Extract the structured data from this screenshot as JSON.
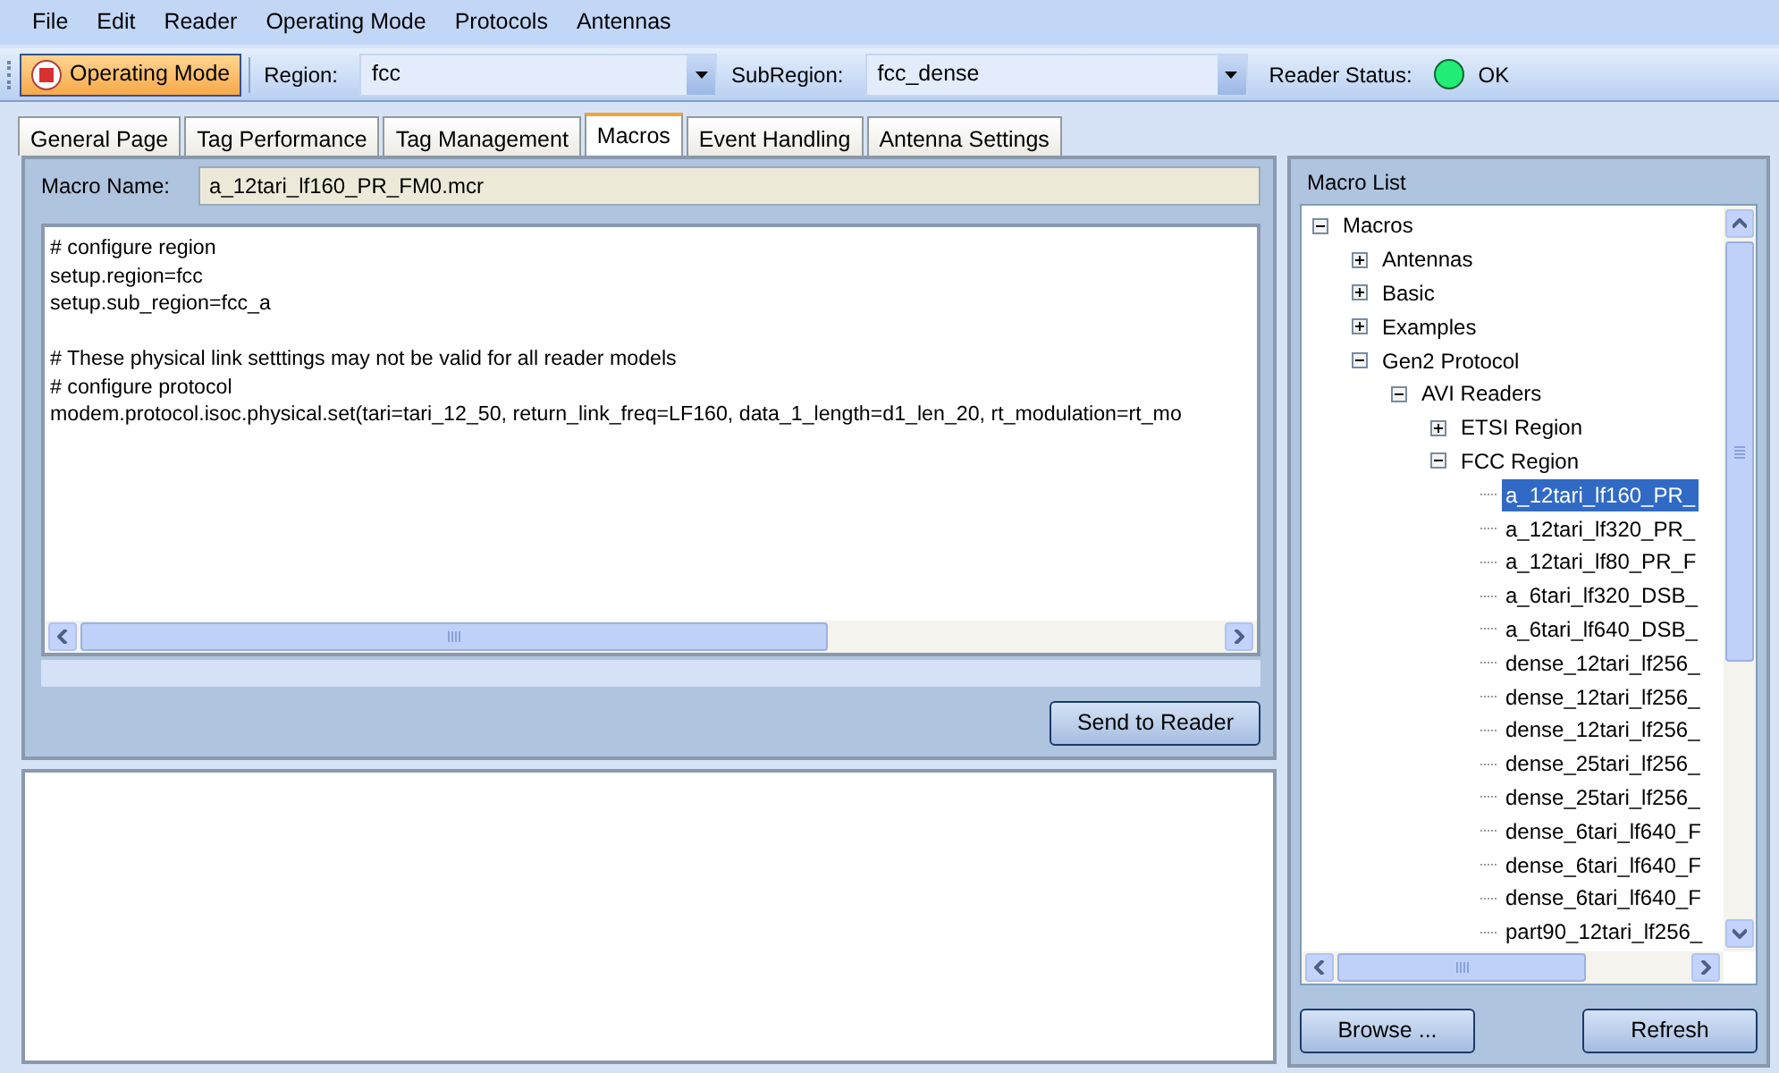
{
  "menu": [
    "File",
    "Edit",
    "Reader",
    "Operating Mode",
    "Protocols",
    "Antennas"
  ],
  "toolbar": {
    "operating_mode_button": "Operating Mode",
    "region": {
      "label": "Region:",
      "value": "fcc"
    },
    "subregion": {
      "label": "SubRegion:",
      "value": "fcc_dense"
    },
    "reader_status": {
      "label": "Reader Status:",
      "color": "#22ee77",
      "value": "OK"
    }
  },
  "tabs": [
    {
      "label": "General Page",
      "selected": false
    },
    {
      "label": "Tag Performance",
      "selected": false
    },
    {
      "label": "Tag Management",
      "selected": false
    },
    {
      "label": "Macros",
      "selected": true
    },
    {
      "label": "Event Handling",
      "selected": false
    },
    {
      "label": "Antenna Settings",
      "selected": false
    }
  ],
  "macro_editor": {
    "name_label": "Macro Name:",
    "name_value": "a_12tari_lf160_PR_FM0.mcr",
    "blocks": [
      [
        "# configure region",
        "setup.region=fcc",
        "setup.sub_region=fcc_a"
      ],
      [
        "# These physical link setttings may not be valid for all reader models",
        "# configure protocol",
        "modem.protocol.isoc.physical.set(tari=tari_12_50, return_link_freq=LF160, data_1_length=d1_len_20, rt_modulation=rt_mo"
      ]
    ],
    "send_button": "Send to Reader"
  },
  "macro_list": {
    "title": "Macro List",
    "tree": [
      {
        "label": "Macros",
        "expanded": true,
        "children": [
          {
            "label": "Antennas",
            "expanded": false
          },
          {
            "label": "Basic",
            "expanded": false
          },
          {
            "label": "Examples",
            "expanded": false
          },
          {
            "label": "Gen2 Protocol",
            "expanded": true,
            "children": [
              {
                "label": "AVI Readers",
                "expanded": true,
                "children": [
                  {
                    "label": "ETSI Region",
                    "expanded": false
                  },
                  {
                    "label": "FCC Region",
                    "expanded": true,
                    "children": [
                      {
                        "label": "a_12tari_lf160_PR_",
                        "selected": true
                      },
                      {
                        "label": "a_12tari_lf320_PR_",
                        "selected": false
                      },
                      {
                        "label": "a_12tari_lf80_PR_F",
                        "selected": false
                      },
                      {
                        "label": "a_6tari_lf320_DSB_",
                        "selected": false
                      },
                      {
                        "label": "a_6tari_lf640_DSB_",
                        "selected": false
                      },
                      {
                        "label": "dense_12tari_lf256_",
                        "selected": false
                      },
                      {
                        "label": "dense_12tari_lf256_",
                        "selected": false
                      },
                      {
                        "label": "dense_12tari_lf256_",
                        "selected": false
                      },
                      {
                        "label": "dense_25tari_lf256_",
                        "selected": false
                      },
                      {
                        "label": "dense_25tari_lf256_",
                        "selected": false
                      },
                      {
                        "label": "dense_6tari_lf640_F",
                        "selected": false
                      },
                      {
                        "label": "dense_6tari_lf640_F",
                        "selected": false
                      },
                      {
                        "label": "dense_6tari_lf640_F",
                        "selected": false
                      },
                      {
                        "label": "part90_12tari_lf256_",
                        "selected": false
                      }
                    ]
                  }
                ]
              }
            ]
          }
        ]
      }
    ],
    "buttons": [
      "Browse ...",
      "Refresh"
    ]
  }
}
